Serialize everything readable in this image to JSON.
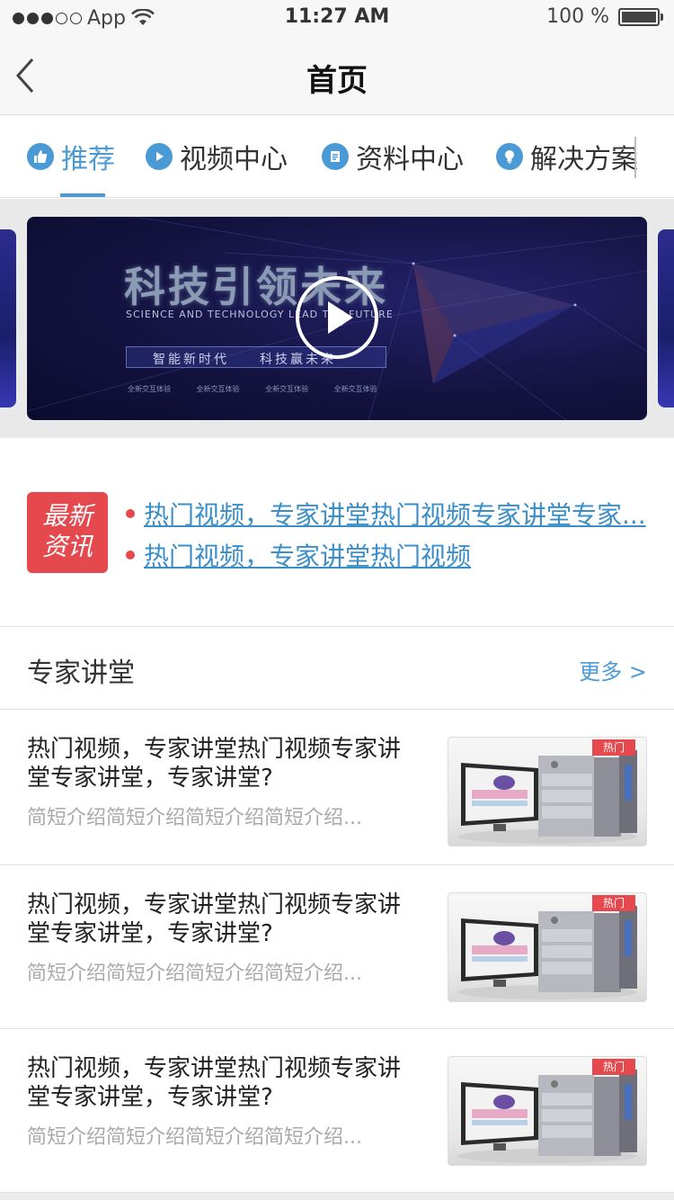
{
  "status_bar": {
    "carrier": "App",
    "time": "11:27 AM",
    "battery": "100 %"
  },
  "nav": {
    "title": "首页"
  },
  "tabs": [
    {
      "label": "推荐",
      "icon": "thumbs-up-icon",
      "active": true
    },
    {
      "label": "视频中心",
      "icon": "play-icon",
      "active": false
    },
    {
      "label": "资料中心",
      "icon": "document-icon",
      "active": false
    },
    {
      "label": "解决方案",
      "icon": "lightbulb-icon",
      "active": false
    }
  ],
  "banner": {
    "title": "科技引领未来",
    "subtitle": "SCIENCE AND TECHNOLOGY LEAD THE FUTURE",
    "slogan": "智能新时代　　科技赢未来",
    "footer": "全新交互体验 全新交互体验 全新交互体验 全新交互体验"
  },
  "news": {
    "badge_line1": "最新",
    "badge_line2": "资讯",
    "items": [
      "热门视频，专家讲堂热门视频专家讲堂专家...",
      "热门视频，专家讲堂热门视频"
    ]
  },
  "section": {
    "title": "专家讲堂",
    "more": "更多 >"
  },
  "lectures": [
    {
      "title": "热门视频，专家讲堂热门视频专家讲堂专家讲堂，专家讲堂?",
      "desc": "简短介绍简短介绍简短介绍简短介绍...",
      "tag": "热门"
    },
    {
      "title": "热门视频，专家讲堂热门视频专家讲堂专家讲堂，专家讲堂?",
      "desc": "简短介绍简短介绍简短介绍简短介绍...",
      "tag": "热门"
    },
    {
      "title": "热门视频，专家讲堂热门视频专家讲堂专家讲堂，专家讲堂?",
      "desc": "简短介绍简短介绍简短介绍简短介绍...",
      "tag": "热门"
    }
  ],
  "colors": {
    "accent": "#4a9ad6",
    "badge_red": "#e5484d",
    "link_blue": "#3a8fcb"
  }
}
